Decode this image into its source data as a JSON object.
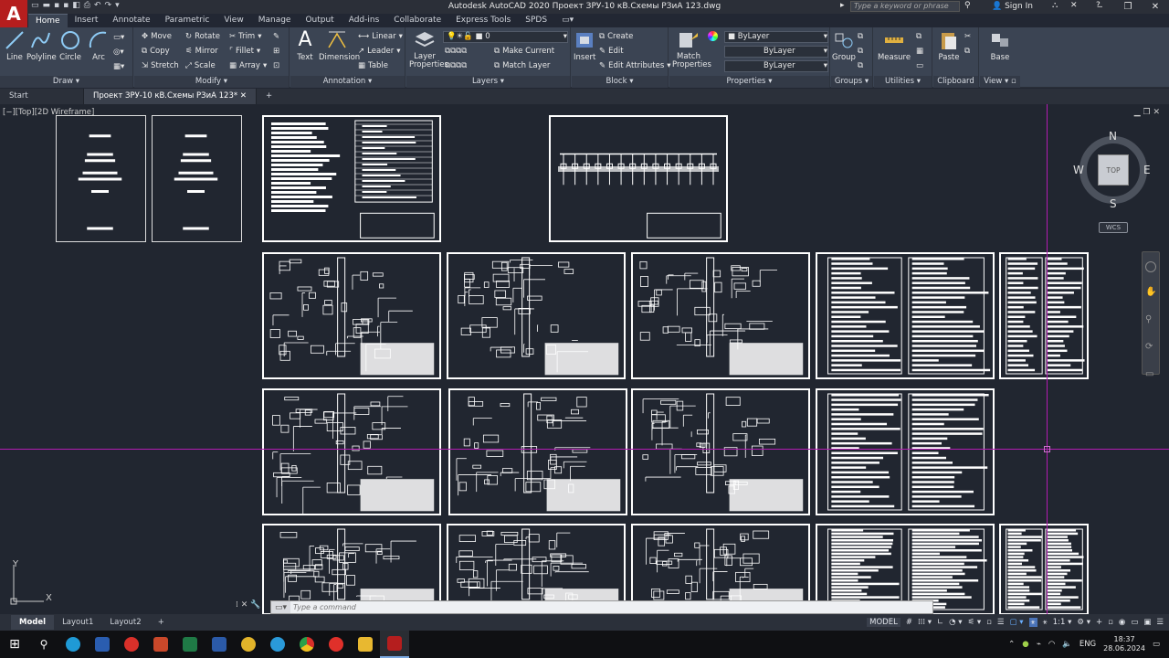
{
  "window": {
    "title": "Autodesk AutoCAD 2020   Проект ЗРУ-10 кВ.Схемы РЗиА 123.dwg",
    "search_placeholder": "Type a keyword or phrase",
    "sign_in": "Sign In"
  },
  "ribbon_tabs": [
    "Home",
    "Insert",
    "Annotate",
    "Parametric",
    "View",
    "Manage",
    "Output",
    "Add-ins",
    "Collaborate",
    "Express Tools",
    "SPDS"
  ],
  "panels": {
    "draw": {
      "title": "Draw",
      "line": "Line",
      "polyline": "Polyline",
      "circle": "Circle",
      "arc": "Arc"
    },
    "modify": {
      "title": "Modify",
      "move": "Move",
      "rotate": "Rotate",
      "trim": "Trim",
      "copy": "Copy",
      "mirror": "Mirror",
      "fillet": "Fillet",
      "stretch": "Stretch",
      "scale": "Scale",
      "array": "Array"
    },
    "annotation": {
      "title": "Annotation",
      "text": "Text",
      "dimension": "Dimension",
      "linear": "Linear",
      "leader": "Leader",
      "table": "Table"
    },
    "layers": {
      "title": "Layers",
      "layer_properties": "Layer Properties",
      "current_layer": "0",
      "make_current": "Make Current",
      "match_layer": "Match Layer"
    },
    "block": {
      "title": "Block",
      "insert": "Insert",
      "create": "Create",
      "edit": "Edit",
      "edit_attributes": "Edit Attributes"
    },
    "properties": {
      "title": "Properties",
      "match_properties": "Match Properties",
      "color": "ByLayer",
      "linetype": "ByLayer",
      "lineweight": "ByLayer"
    },
    "groups": {
      "title": "Groups",
      "group": "Group"
    },
    "utilities": {
      "title": "Utilities",
      "measure": "Measure"
    },
    "clipboard": {
      "title": "Clipboard",
      "paste": "Paste"
    },
    "view": {
      "title": "View",
      "base": "Base"
    }
  },
  "doc_tabs": [
    "Start",
    "Проект ЗРУ-10 кВ.Схемы РЗиА 123*"
  ],
  "viewport_label": "[−][Top][2D Wireframe]",
  "viewcube": {
    "top": "TOP",
    "n": "N",
    "s": "S",
    "e": "E",
    "w": "W",
    "wcs": "WCS"
  },
  "ucs": {
    "x": "X",
    "y": "Y"
  },
  "command_placeholder": "Type a command",
  "layout_tabs": [
    "Model",
    "Layout1",
    "Layout2"
  ],
  "status": {
    "model": "MODEL",
    "scale": "1:1"
  },
  "tray": {
    "lang": "ENG",
    "time": "18:37",
    "date": "28.06.2024"
  }
}
